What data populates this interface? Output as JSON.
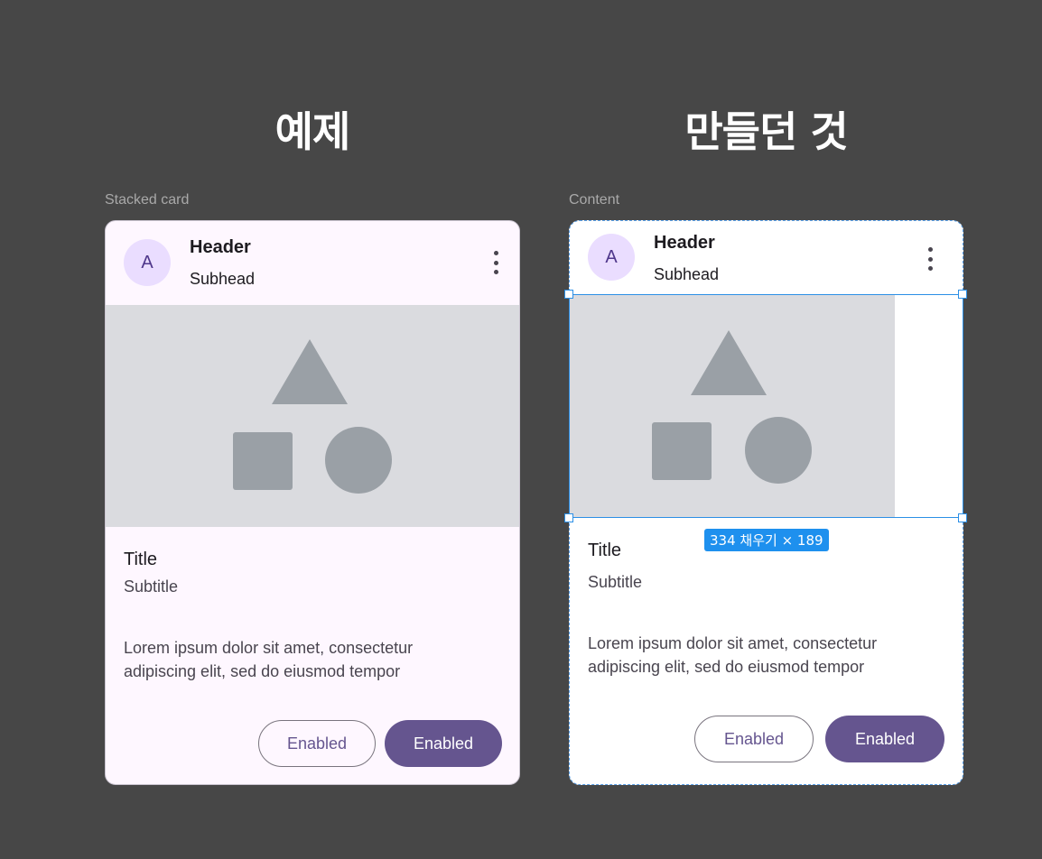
{
  "headings": {
    "left": "예제",
    "right": "만들던 것"
  },
  "frame_labels": {
    "left": "Stacked card",
    "right": "Content"
  },
  "card": {
    "avatar_letter": "A",
    "header": "Header",
    "subhead": "Subhead",
    "title": "Title",
    "subtitle": "Subtitle",
    "body_line1": "Lorem ipsum dolor sit amet, consectetur",
    "body_line2": "adipiscing elit, sed do eiusmod tempor",
    "outlined_button": "Enabled",
    "filled_button": "Enabled"
  },
  "selection": {
    "dimension_label": "334 채우기 × 189"
  },
  "colors": {
    "background": "#474747",
    "card_surface": "#fef7ff",
    "primary": "#65558f",
    "avatar_bg": "#eaddff",
    "media_bg": "#dadbdf",
    "shape": "#9aa0a6",
    "selection": "#2b8fe6"
  }
}
